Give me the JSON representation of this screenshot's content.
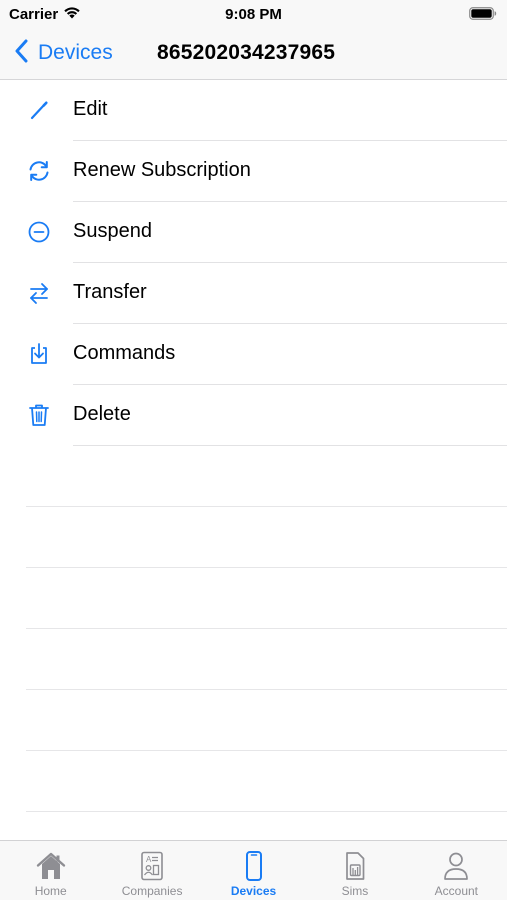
{
  "status_bar": {
    "carrier": "Carrier",
    "time": "9:08 PM"
  },
  "nav": {
    "back_label": "Devices",
    "title": "865202034237965"
  },
  "menu": {
    "items": [
      {
        "label": "Edit",
        "icon": "pencil-icon"
      },
      {
        "label": "Renew Subscription",
        "icon": "refresh-icon"
      },
      {
        "label": "Suspend",
        "icon": "minus-circle-icon"
      },
      {
        "label": "Transfer",
        "icon": "transfer-arrows-icon"
      },
      {
        "label": "Commands",
        "icon": "download-tray-icon"
      },
      {
        "label": "Delete",
        "icon": "trash-icon"
      }
    ]
  },
  "tab_bar": {
    "tabs": [
      {
        "label": "Home",
        "icon": "house-icon",
        "active": false
      },
      {
        "label": "Companies",
        "icon": "contact-card-icon",
        "active": false
      },
      {
        "label": "Devices",
        "icon": "phone-icon",
        "active": true
      },
      {
        "label": "Sims",
        "icon": "sim-card-icon",
        "active": false
      },
      {
        "label": "Account",
        "icon": "person-icon",
        "active": false
      }
    ]
  },
  "colors": {
    "accent": "#1a7cf4",
    "inactive": "#8e8e93",
    "bar_background": "#f8f8f8",
    "separator": "#e2e2e4"
  }
}
